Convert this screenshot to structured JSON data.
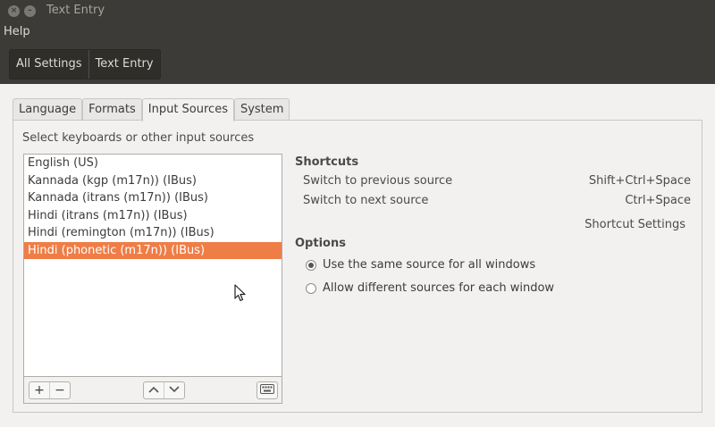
{
  "window": {
    "title": "Text Entry",
    "close_glyph": "×",
    "min_glyph": "–"
  },
  "menu": {
    "help": "Help"
  },
  "breadcrumbs": [
    "All Settings",
    "Text Entry"
  ],
  "tabs": [
    "Language",
    "Formats",
    "Input Sources",
    "System"
  ],
  "active_tab": "Input Sources",
  "sources": {
    "header": "Select keyboards or other input sources",
    "items": [
      "English (US)",
      "Kannada (kgp (m17n)) (IBus)",
      "Kannada (itrans (m17n)) (IBus)",
      "Hindi (itrans (m17n)) (IBus)",
      "Hindi (remington (m17n)) (IBus)",
      "Hindi (phonetic (m17n)) (IBus)"
    ],
    "selected_index": 5,
    "buttons": {
      "add": "+",
      "remove": "−",
      "up": "︿",
      "down": "﹀"
    }
  },
  "shortcuts": {
    "title": "Shortcuts",
    "rows": [
      {
        "label": "Switch to previous source",
        "keys": "Shift+Ctrl+Space"
      },
      {
        "label": "Switch to next source",
        "keys": "Ctrl+Space"
      }
    ],
    "settings_button": "Shortcut Settings"
  },
  "options": {
    "title": "Options",
    "choices": [
      {
        "label": "Use the same source for all windows",
        "checked": true
      },
      {
        "label": "Allow different sources for each window",
        "checked": false
      }
    ]
  },
  "colors": {
    "selection": "#ef7d46",
    "titlebar": "#3c3b37"
  },
  "icons": [
    "close-icon",
    "minimize-icon",
    "add-icon",
    "remove-icon",
    "move-up-icon",
    "move-down-icon",
    "keyboard-icon",
    "mouse-cursor-icon"
  ]
}
